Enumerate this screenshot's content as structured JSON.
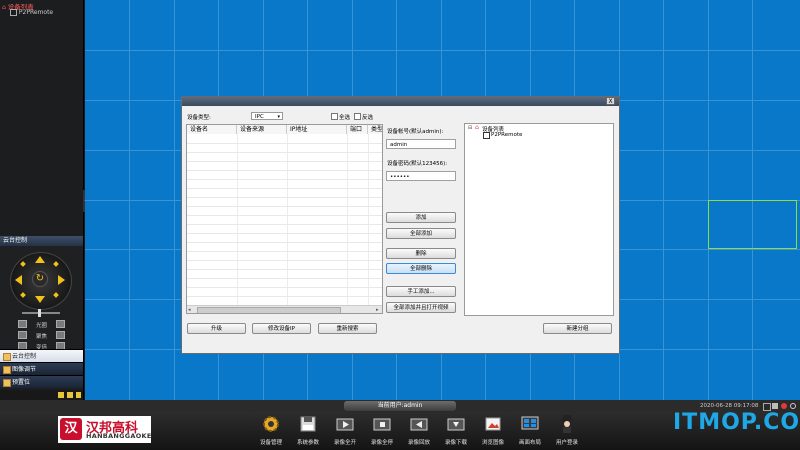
{
  "left_panel": {
    "tree_root": "设备列表",
    "tree_child": "P2PRemote",
    "collapse_glyph": "«",
    "ptz_header": "云台控制",
    "ptz_rows": [
      {
        "label": "光圈"
      },
      {
        "label": "聚焦"
      },
      {
        "label": "变倍"
      }
    ],
    "tabs": [
      {
        "label": "云台控制",
        "active": true
      },
      {
        "label": "图像调节",
        "active": false
      },
      {
        "label": "预置位",
        "active": false
      }
    ]
  },
  "dialog": {
    "close_glyph": "X",
    "device_type_label": "设备类型:",
    "device_type_value": "IPC",
    "check_all_label": "全选",
    "invert_label": "反选",
    "table_headers": [
      "设备名",
      "设备来源",
      "IP地址",
      "端口",
      "类型"
    ],
    "username_label": "设备帐号(默认admin):",
    "username_value": "admin",
    "password_label": "设备密码(默认123456):",
    "password_value": "••••••",
    "buttons": {
      "add": "添加",
      "add_all": "全部添加",
      "delete": "删除",
      "delete_all": "全部删除",
      "manual_add": "手工添加...",
      "delete_all_open": "全部添加并且打开视频",
      "upgrade": "升级",
      "modify_ip": "修改设备IP",
      "refresh": "重新搜索",
      "new_group": "新建分组"
    },
    "right_tree_root": "设备列表",
    "right_tree_child": "P2PRemote"
  },
  "status": {
    "center": "当前用户:admin",
    "datetime": "2020-06-28 09:17:08"
  },
  "logo": {
    "mark": "汉",
    "name_cn": "汉邦高科",
    "name_en": "HANBANGGAOKE"
  },
  "toolbar": [
    {
      "label": "设备管理",
      "icon": "gear-icon"
    },
    {
      "label": "系统参数",
      "icon": "save-icon"
    },
    {
      "label": "录像全开",
      "icon": "video-play-icon"
    },
    {
      "label": "录像全停",
      "icon": "video-stop-icon"
    },
    {
      "label": "录像回放",
      "icon": "playback-icon"
    },
    {
      "label": "录像下载",
      "icon": "download-icon"
    },
    {
      "label": "浏览图像",
      "icon": "image-icon"
    },
    {
      "label": "画面布局",
      "icon": "layout-icon"
    },
    {
      "label": "用户登录",
      "icon": "user-icon"
    }
  ],
  "watermark": "ITMOP.COM",
  "colors": {
    "grid": "#0a78c8",
    "grid_line": "#3a93d8",
    "selected_cell": "#8fdc4a",
    "brand_red": "#c8102e",
    "watermark": "#1ea8e8"
  }
}
